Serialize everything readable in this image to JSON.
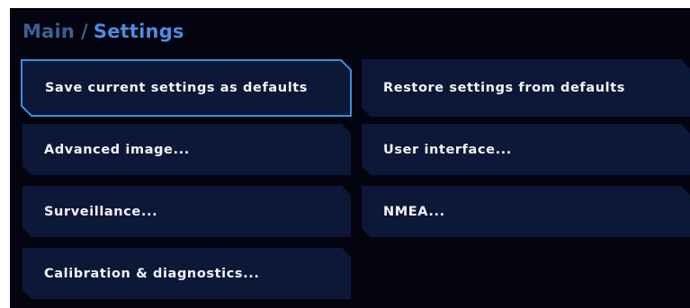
{
  "breadcrumb": {
    "root": "Main",
    "separator": "/",
    "current": "Settings"
  },
  "menu": {
    "items": [
      {
        "label": "Save current settings as defaults",
        "selected": true
      },
      {
        "label": "Restore settings from defaults"
      },
      {
        "label": "Advanced image..."
      },
      {
        "label": "User interface..."
      },
      {
        "label": "Surveillance..."
      },
      {
        "label": "NMEA..."
      },
      {
        "label": "Calibration & diagnostics..."
      }
    ]
  },
  "colors": {
    "background": "#03040f",
    "button": "#0d1737",
    "focus": "#3b8fe0",
    "breadcrumb_root": "#3f5f95",
    "breadcrumb_current": "#4f8be0",
    "text": "#f2f4f8"
  }
}
